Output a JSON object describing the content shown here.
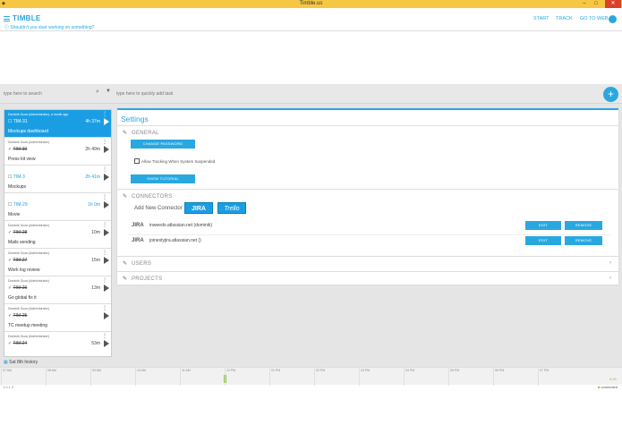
{
  "window": {
    "title": "Timble.us",
    "controls": [
      "minimize",
      "maximize",
      "close"
    ]
  },
  "header": {
    "brand": "TIMBLE",
    "nav": [
      "START",
      "TRACK",
      "GO TO WEB"
    ],
    "hint": "Shouldn't you start working on something?"
  },
  "search": {
    "placeholder": "type here to search",
    "quick_add_placeholder": "type here to quickly add task"
  },
  "entries": [
    {
      "owner": "Dominik Guza (Administrator), a month ago",
      "ticket": "TIM-31",
      "desc": "Mockups dashboard",
      "dur": "4h 37m",
      "status": "square",
      "active": true
    },
    {
      "owner": "Dominik Guza (Administrator)",
      "ticket": "TIM-30",
      "desc": "Press kit view",
      "dur": "2h 49m",
      "status": "done"
    },
    {
      "owner": "",
      "ticket": "TIM-3",
      "desc": "Mockups",
      "dur": "2h 41m",
      "status": "square",
      "blue": true
    },
    {
      "owner": "",
      "ticket": "TIM-29",
      "desc": "Movie",
      "dur": "1h 0m",
      "status": "square",
      "blue": true
    },
    {
      "owner": "Dominik Guza (Administrator)",
      "ticket": "TIM-28",
      "desc": "Mails sending",
      "dur": "10m",
      "status": "done"
    },
    {
      "owner": "Dominik Guza (Administrator)",
      "ticket": "TIM-27",
      "desc": "Work log review",
      "dur": "15m",
      "status": "done"
    },
    {
      "owner": "Dominik Guza (Administrator)",
      "ticket": "TIM-26",
      "desc": "Go global fix it",
      "dur": "13m",
      "status": "done"
    },
    {
      "owner": "Dominik Guza (Administrator)",
      "ticket": "TIM-25",
      "desc": "TC meetup meeting",
      "dur": "",
      "status": "done"
    },
    {
      "owner": "Dominik Guza (Administrator)",
      "ticket": "TIM-24",
      "desc": "",
      "dur": "53m",
      "status": "done"
    }
  ],
  "history_label": "Sat 8th history",
  "settings": {
    "title": "Settings",
    "general": {
      "label": "GENERAL",
      "change_password": "CHANGE PASSWORD",
      "allow_tracking": "Allow Tracking When System Suspended",
      "show_tutorial": "SHOW TUTORIAL"
    },
    "connectors": {
      "label": "CONNECTORS",
      "add_new": "Add New Connector",
      "jira_logo": "JIRA",
      "trello_logo": "Trello",
      "rows": [
        {
          "logo": "JIRA",
          "name": "inweedo.atlassian.net (dominik)",
          "edit": "EDIT",
          "remove": "REMOVE"
        },
        {
          "logo": "JIRA",
          "name": "joinestyjira.atlassian.net ()",
          "edit": "EDIT",
          "remove": "REMOVE"
        }
      ]
    },
    "users": {
      "label": "USERS"
    },
    "projects": {
      "label": "PROJECTS"
    }
  },
  "timeline": {
    "ticks": [
      "07 AM",
      "08 AM",
      "09 AM",
      "10 AM",
      "11 AM",
      "12 PM",
      "01 PM",
      "02 PM",
      "03 PM",
      "04 PM",
      "05 PM",
      "06 PM",
      "07 PM"
    ],
    "end_label": "0:00",
    "version": "1.0.1.0",
    "status": "connected"
  },
  "colors": {
    "accent": "#29a8e0",
    "titlebar": "#f5c742",
    "close": "#d9412c",
    "status_ok": "#8bc34a"
  }
}
